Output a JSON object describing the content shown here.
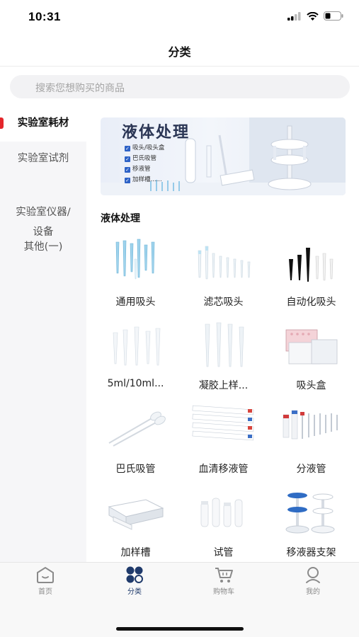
{
  "status_bar": {
    "time": "10:31"
  },
  "header": {
    "title": "分类"
  },
  "search": {
    "placeholder": "搜索您想购买的商品"
  },
  "sidebar": {
    "items": [
      {
        "label": "实验室耗材",
        "active": true
      },
      {
        "label": "实验室试剂"
      },
      {
        "label": "实验室仪器/\n设备"
      },
      {
        "label": "其他(一)"
      }
    ]
  },
  "banner": {
    "title": "液体处理",
    "bullets": [
      "吸头/吸头盒",
      "巴氏吸管",
      "移液管",
      "加样槽......"
    ]
  },
  "section": {
    "title": "液体处理"
  },
  "products": [
    {
      "label": "通用吸头",
      "icon": "pipette-tips-icon"
    },
    {
      "label": "滤芯吸头",
      "icon": "filter-tips-icon"
    },
    {
      "label": "自动化吸头",
      "icon": "automation-tips-icon"
    },
    {
      "label": "5ml/10ml...",
      "icon": "large-tips-icon"
    },
    {
      "label": "凝胶上样...",
      "icon": "gel-loading-tips-icon"
    },
    {
      "label": "吸头盒",
      "icon": "tip-box-icon"
    },
    {
      "label": "巴氏吸管",
      "icon": "pasteur-pipette-icon"
    },
    {
      "label": "血清移液管",
      "icon": "serological-pipette-icon"
    },
    {
      "label": "分液管",
      "icon": "dispenser-tube-icon"
    },
    {
      "label": "加样槽",
      "icon": "reservoir-icon"
    },
    {
      "label": "试管",
      "icon": "test-tube-icon"
    },
    {
      "label": "移液器支架",
      "icon": "pipette-stand-icon"
    }
  ],
  "tabbar": {
    "items": [
      {
        "label": "首页",
        "icon": "home-icon"
      },
      {
        "label": "分类",
        "icon": "category-icon",
        "active": true
      },
      {
        "label": "购物车",
        "icon": "cart-icon"
      },
      {
        "label": "我的",
        "icon": "profile-icon"
      }
    ]
  },
  "colors": {
    "accent_red": "#e4262b",
    "active_tab": "#1f3a6b"
  }
}
